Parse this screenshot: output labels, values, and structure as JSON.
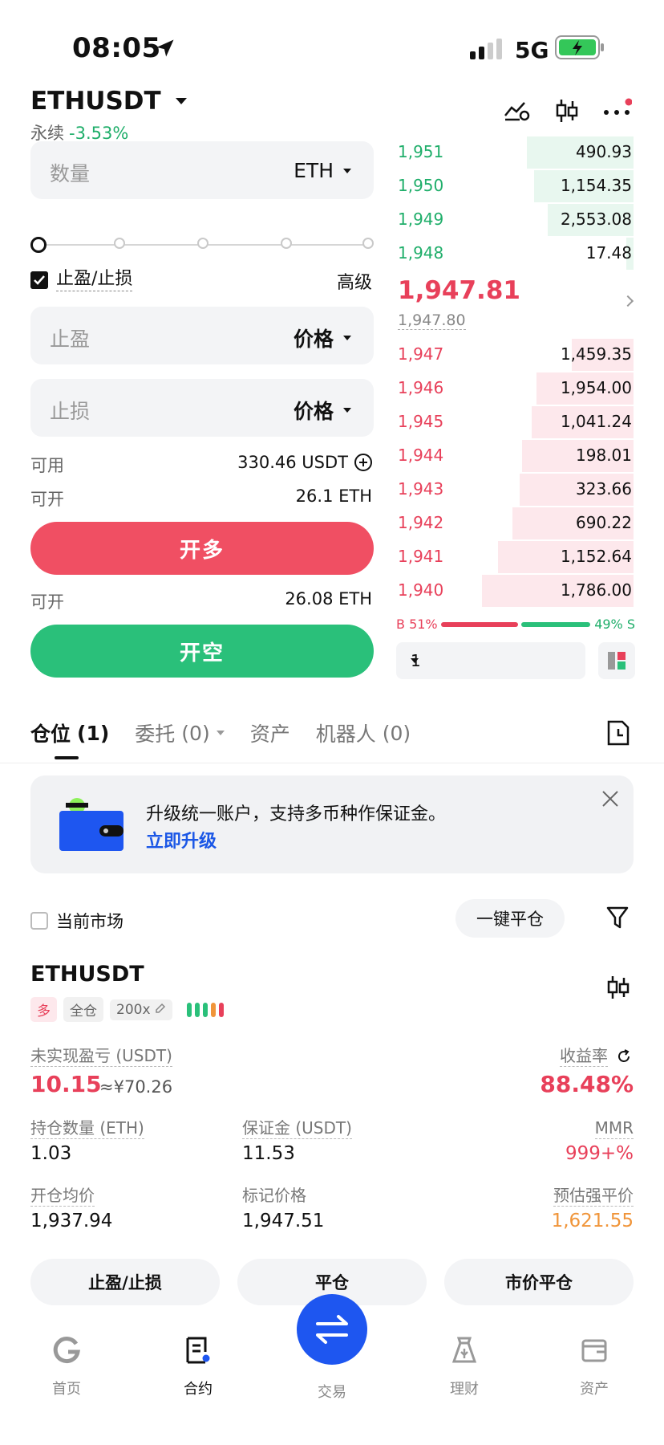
{
  "status": {
    "time": "08:05",
    "network": "5G"
  },
  "header": {
    "pair": "ETHUSDT",
    "type": "永续",
    "change": "-3.53%"
  },
  "form": {
    "qty_placeholder": "数量",
    "qty_unit": "ETH",
    "tpsl_label": "止盈/止损",
    "advanced": "高级",
    "tp_placeholder": "止盈",
    "tp_mode": "价格",
    "sl_placeholder": "止损",
    "sl_mode": "价格",
    "available_label": "可用",
    "available_value": "330.46 USDT",
    "open_long_label": "可开",
    "open_long_value": "26.1 ETH",
    "buy_button": "开多",
    "open_short_label": "可开",
    "open_short_value": "26.08 ETH",
    "sell_button": "开空"
  },
  "orderbook": {
    "asks": [
      {
        "price": "1,951",
        "qty": "490.93",
        "depth": 0.45
      },
      {
        "price": "1,950",
        "qty": "1,154.35",
        "depth": 0.42
      },
      {
        "price": "1,949",
        "qty": "2,553.08",
        "depth": 0.36
      },
      {
        "price": "1,948",
        "qty": "17.48",
        "depth": 0.03
      }
    ],
    "last_price": "1,947.81",
    "mark_price": "1,947.80",
    "bids": [
      {
        "price": "1,947",
        "qty": "1,459.35",
        "depth": 0.26
      },
      {
        "price": "1,946",
        "qty": "1,954.00",
        "depth": 0.41
      },
      {
        "price": "1,945",
        "qty": "1,041.24",
        "depth": 0.43
      },
      {
        "price": "1,944",
        "qty": "198.01",
        "depth": 0.47
      },
      {
        "price": "1,943",
        "qty": "323.66",
        "depth": 0.48
      },
      {
        "price": "1,942",
        "qty": "690.22",
        "depth": 0.51
      },
      {
        "price": "1,941",
        "qty": "1,152.64",
        "depth": 0.57
      },
      {
        "price": "1,940",
        "qty": "1,786.00",
        "depth": 0.64
      }
    ],
    "buy_ratio": "B 51%",
    "sell_ratio": "49% S",
    "depth_value": "1"
  },
  "tabs": [
    {
      "label": "仓位",
      "count": "(1)"
    },
    {
      "label": "委托",
      "count": "(0)"
    },
    {
      "label": "资产",
      "count": ""
    },
    {
      "label": "机器人",
      "count": "(0)"
    }
  ],
  "banner": {
    "text": "升级统一账户，支持多币种作保证金。",
    "link": "立即升级"
  },
  "filters": {
    "current_market": "当前市场",
    "close_all": "一键平仓"
  },
  "position": {
    "pair": "ETHUSDT",
    "side": "多",
    "margin_mode": "全仓",
    "leverage": "200x",
    "pnl_label": "未实现盈亏 (USDT)",
    "pnl": "10.15",
    "pnl_cny": "≈¥70.26",
    "roi_label": "收益率",
    "roi": "88.48%",
    "size_label": "持仓数量 (ETH)",
    "size": "1.03",
    "margin_label": "保证金 (USDT)",
    "margin": "11.53",
    "mmr_label": "MMR",
    "mmr": "999+%",
    "entry_label": "开仓均价",
    "entry": "1,937.94",
    "markp_label": "标记价格",
    "markp": "1,947.51",
    "liq_label": "预估强平价",
    "liq": "1,621.55",
    "btn_tpsl": "止盈/止损",
    "btn_close": "平仓",
    "btn_market_close": "市价平仓"
  },
  "nav": {
    "home": "首页",
    "contract": "合约",
    "trade": "交易",
    "finance": "理财",
    "assets": "资产"
  },
  "colors": {
    "green": "#1fae6a",
    "red": "#e8405a",
    "liq": "#f0953a",
    "blue": "#1e56f0"
  }
}
